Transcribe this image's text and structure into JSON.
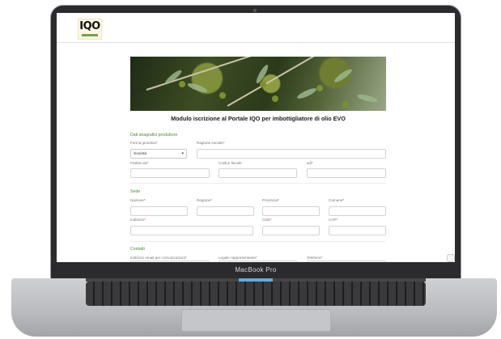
{
  "device": {
    "bezel_label": "MacBook Pro"
  },
  "header": {
    "logo_text": "IQO"
  },
  "form": {
    "title": "Modulo iscrizione al Portale IQO per imbottigliatore di olio EVO",
    "sections": {
      "anagrafici": "Dati anagrafici produttore",
      "sede": "Sede",
      "contatti": "Contatti"
    },
    "fields": {
      "forma_giuridica": {
        "label": "Forma giuridica",
        "value": "Società"
      },
      "ragione_sociale": {
        "label": "Ragione sociale"
      },
      "partita_iva": {
        "label": "Partita iva"
      },
      "codice_fiscale": {
        "label": "Codice fiscale"
      },
      "sdi": {
        "label": "sdi"
      },
      "nazione": {
        "label": "Nazione"
      },
      "regione": {
        "label": "Regione"
      },
      "provincia": {
        "label": "Provincia"
      },
      "comune": {
        "label": "Comune"
      },
      "indirizzo": {
        "label": "Indirizzo"
      },
      "citta": {
        "label": "Città"
      },
      "cap": {
        "label": "CAP"
      },
      "email": {
        "label": "Indirizzo email per comunicazioni"
      },
      "legale": {
        "label": "Legale rappresentante"
      },
      "telefono": {
        "label": "Telefono"
      }
    },
    "required_mark": "*"
  },
  "colors": {
    "section": "#4d8a2e",
    "required": "#c73232",
    "bezel": "#2b2b2d"
  }
}
